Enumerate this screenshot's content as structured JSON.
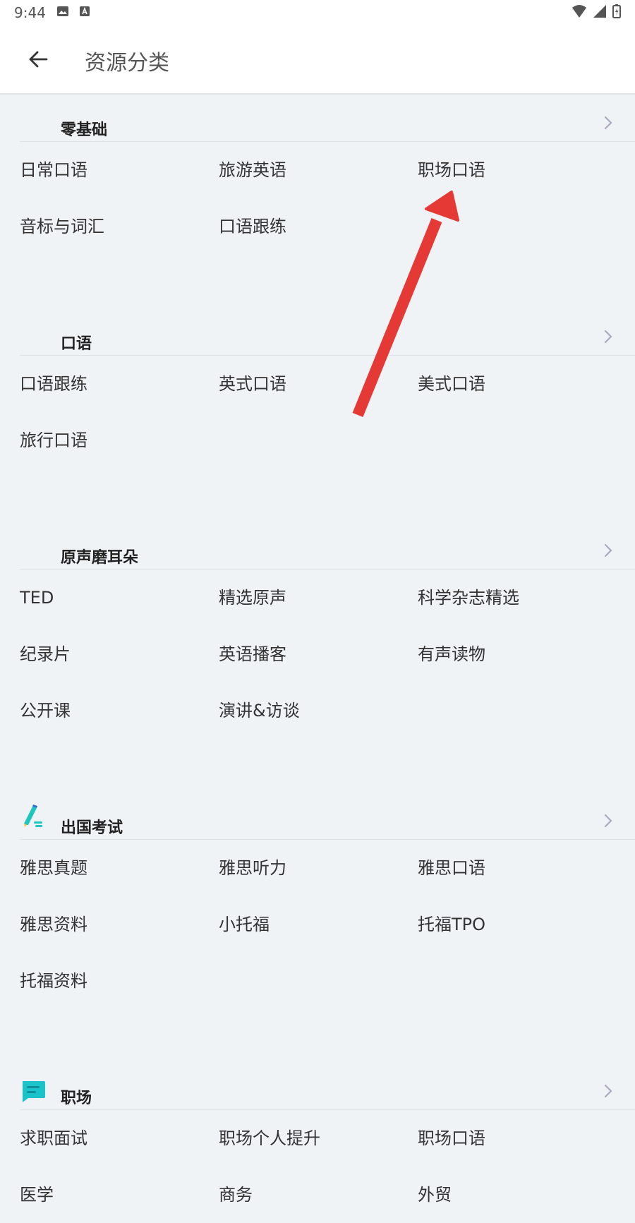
{
  "status_bar": {
    "time": "9:44"
  },
  "header": {
    "title": "资源分类",
    "back_icon": "arrow-left-icon"
  },
  "sections": [
    {
      "title": "零基础",
      "icon": "none",
      "items": [
        "日常口语",
        "旅游英语",
        "职场口语",
        "音标与词汇",
        "口语跟练"
      ]
    },
    {
      "title": "口语",
      "icon": "none",
      "items": [
        "口语跟练",
        "英式口语",
        "美式口语",
        "旅行口语"
      ]
    },
    {
      "title": "原声磨耳朵",
      "icon": "none",
      "items": [
        "TED",
        "精选原声",
        "科学杂志精选",
        "纪录片",
        "英语播客",
        "有声读物",
        "公开课",
        "演讲&访谈"
      ]
    },
    {
      "title": "出国考试",
      "icon": "pencil-icon",
      "items": [
        "雅思真题",
        "雅思听力",
        "雅思口语",
        "雅思资料",
        "小托福",
        "托福TPO",
        "托福资料"
      ]
    },
    {
      "title": "职场",
      "icon": "chat-bubble-icon",
      "items": [
        "求职面试",
        "职场个人提升",
        "职场口语",
        "医学",
        "商务",
        "外贸"
      ]
    }
  ],
  "colors": {
    "background": "#f0f3f6",
    "annotation_arrow": "#e53935",
    "pencil_accent": "#1ec6c0",
    "chat_accent": "#19c3c9"
  }
}
